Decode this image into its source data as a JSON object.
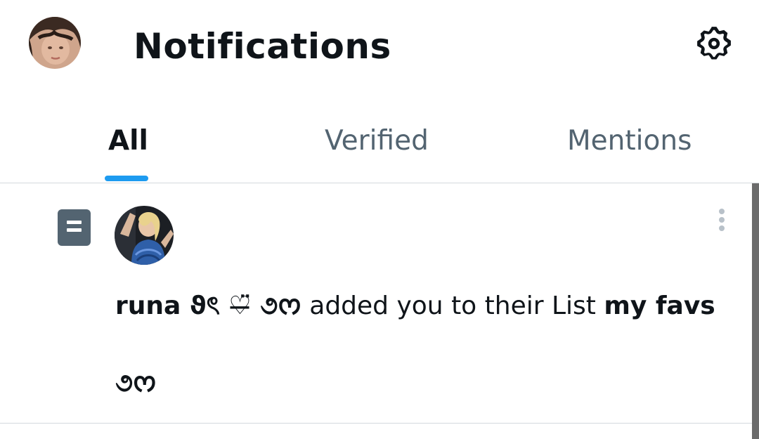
{
  "header": {
    "title": "Notifications",
    "avatar_icon": "user-avatar-icon",
    "settings_icon": "gear-icon"
  },
  "tabs": [
    {
      "label": "All",
      "active": true
    },
    {
      "label": "Verified",
      "active": false
    },
    {
      "label": "Mentions",
      "active": false
    }
  ],
  "notification": {
    "type_icon": "list-icon",
    "sender_name": "runa ϑৎ ♡̶̈ ૭ᰔ",
    "action_text": "added you to their List",
    "list_name_line1": "my favs",
    "list_name_line2": "૭ᰔ",
    "more_icon": "more-vertical-icon"
  },
  "colors": {
    "accent": "#1d9bf0",
    "text_primary": "#0f1419",
    "text_secondary": "#536471",
    "divider": "#d4d9dd"
  }
}
